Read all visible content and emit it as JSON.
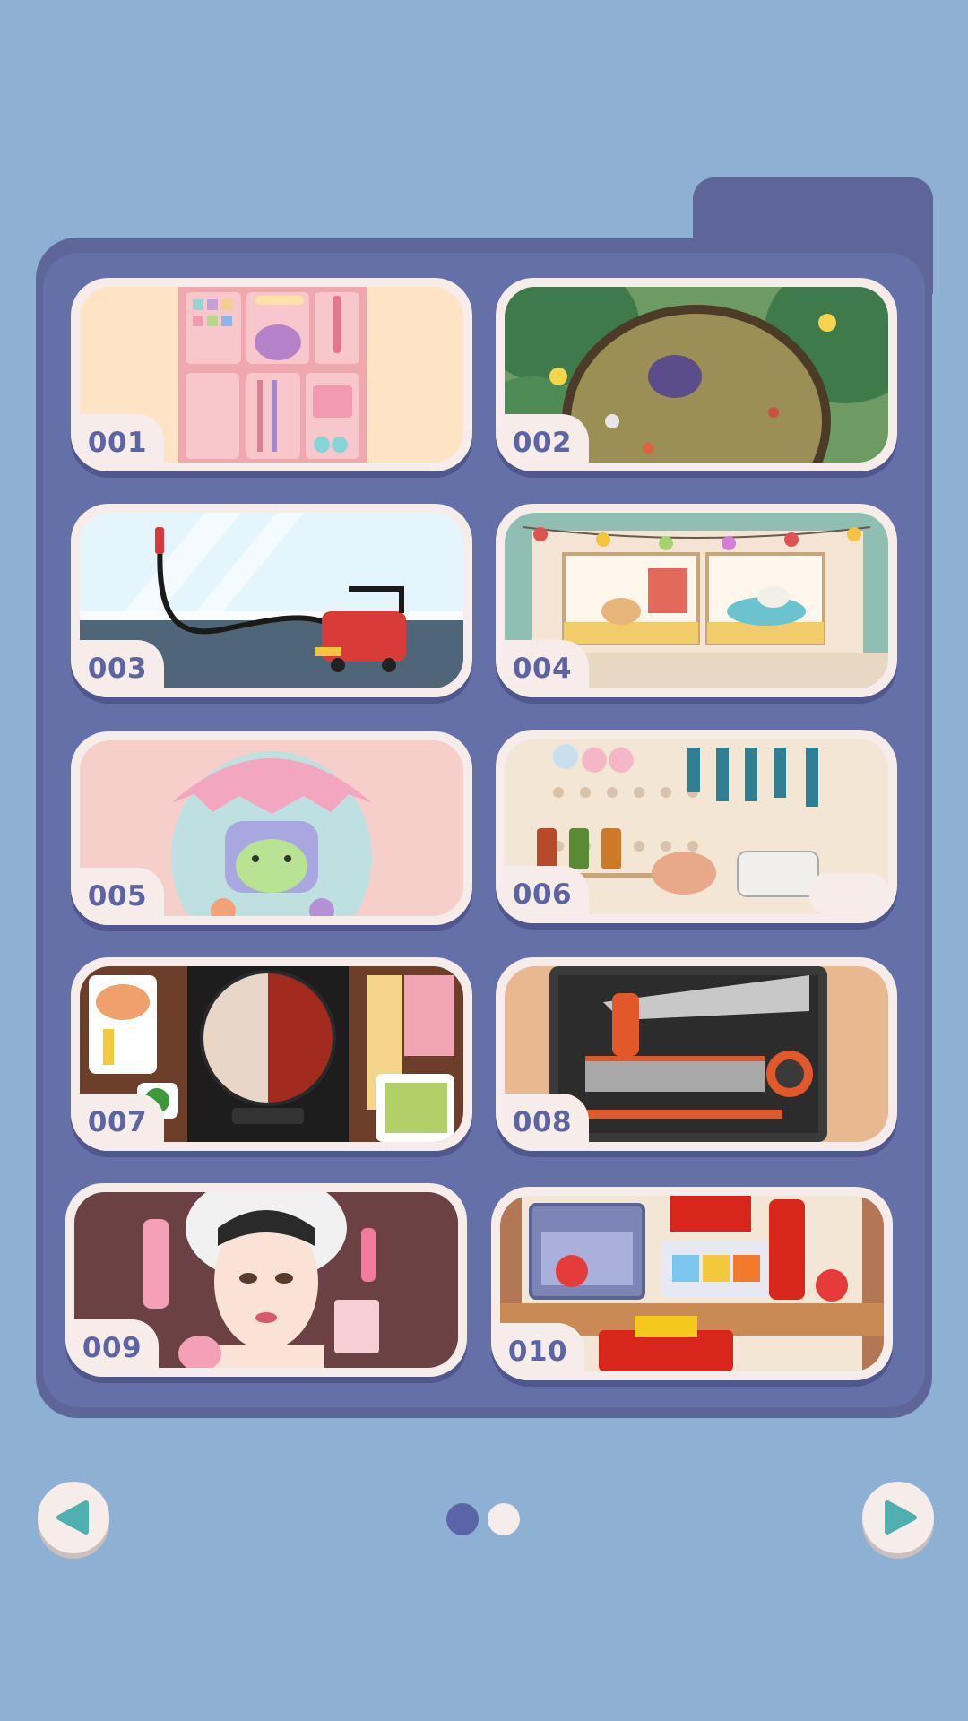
{
  "levels": [
    {
      "number": "001",
      "theme": "makeup-organizer"
    },
    {
      "number": "002",
      "theme": "jungle-cleanup"
    },
    {
      "number": "003",
      "theme": "floor-vacuum"
    },
    {
      "number": "004",
      "theme": "hamster-shelf"
    },
    {
      "number": "005",
      "theme": "frog-egg-pod"
    },
    {
      "number": "006",
      "theme": "kitchen-pegboard"
    },
    {
      "number": "007",
      "theme": "hotpot-table"
    },
    {
      "number": "008",
      "theme": "toolbox"
    },
    {
      "number": "009",
      "theme": "skincare-girl"
    },
    {
      "number": "010",
      "theme": "snack-shelf"
    }
  ],
  "pagination": {
    "current": 1,
    "total": 2
  },
  "nav": {
    "prev_icon": "triangle-left-icon",
    "next_icon": "triangle-right-icon"
  },
  "colors": {
    "background": "#8eb0d3",
    "panel": "#6670a8",
    "card": "#f6ece9",
    "number": "#5c64a2",
    "arrow": "#4fb0b0"
  }
}
